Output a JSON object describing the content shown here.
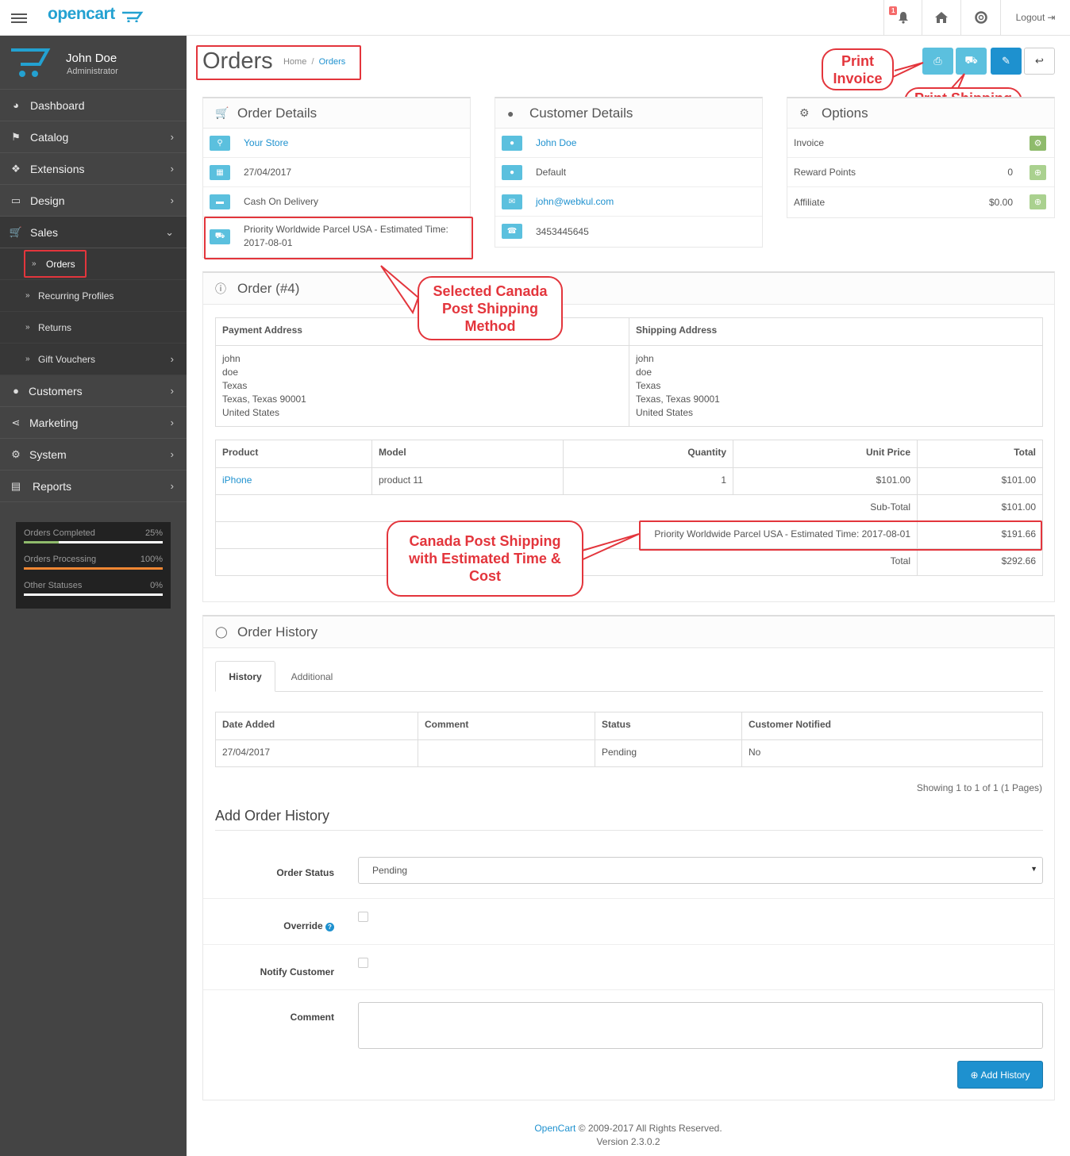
{
  "header": {
    "brand": "opencart",
    "notification_count": "1",
    "logout_label": "Logout"
  },
  "sidebar": {
    "user_name": "John Doe",
    "user_role": "Administrator",
    "items": [
      {
        "label": "Dashboard",
        "icon": "dashboard-icon"
      },
      {
        "label": "Catalog",
        "icon": "tags-icon"
      },
      {
        "label": "Extensions",
        "icon": "puzzle-icon"
      },
      {
        "label": "Design",
        "icon": "monitor-icon"
      },
      {
        "label": "Sales",
        "icon": "cart-icon"
      },
      {
        "label": "Customers",
        "icon": "user-icon"
      },
      {
        "label": "Marketing",
        "icon": "share-icon"
      },
      {
        "label": "System",
        "icon": "gear-icon"
      },
      {
        "label": "Reports",
        "icon": "bar-chart-icon"
      }
    ],
    "sales_sub": [
      "Orders",
      "Recurring Profiles",
      "Returns",
      "Gift Vouchers"
    ],
    "stats": [
      {
        "label": "Orders Completed",
        "percent": "25%",
        "value": 0.25,
        "color": "#8fbb6c"
      },
      {
        "label": "Orders Processing",
        "percent": "100%",
        "value": 1.0,
        "color": "#f38733"
      },
      {
        "label": "Other Statuses",
        "percent": "0%",
        "value": 0,
        "color": "#fff"
      }
    ]
  },
  "page": {
    "title": "Orders",
    "breadcrumb_home": "Home",
    "breadcrumb_current": "Orders"
  },
  "order_details": {
    "title": "Order Details",
    "store": "Your Store",
    "date": "27/04/2017",
    "payment": "Cash On Delivery",
    "shipping": "Priority Worldwide Parcel USA - Estimated Time: 2017-08-01"
  },
  "customer_details": {
    "title": "Customer Details",
    "name": "John Doe",
    "group": "Default",
    "email": "john@webkul.com",
    "phone": "3453445645"
  },
  "options": {
    "title": "Options",
    "invoice_label": "Invoice",
    "reward_label": "Reward Points",
    "reward_value": "0",
    "affiliate_label": "Affiliate",
    "affiliate_value": "$0.00"
  },
  "order": {
    "title": "Order (#4)",
    "payment_address_label": "Payment Address",
    "shipping_address_label": "Shipping Address",
    "payment_address": [
      "john",
      "doe",
      "Texas",
      "Texas, Texas 90001",
      "United States"
    ],
    "shipping_address": [
      "john",
      "doe",
      "Texas",
      "Texas, Texas 90001",
      "United States"
    ],
    "columns": [
      "Product",
      "Model",
      "Quantity",
      "Unit Price",
      "Total"
    ],
    "product": {
      "name": "iPhone",
      "model": "product 11",
      "qty": "1",
      "unit": "$101.00",
      "total": "$101.00"
    },
    "subtotal_label": "Sub-Total",
    "subtotal": "$101.00",
    "shipping_label": "Priority Worldwide Parcel USA - Estimated Time: 2017-08-01",
    "shipping_cost": "$191.66",
    "total_label": "Total",
    "total": "$292.66"
  },
  "history": {
    "title": "Order History",
    "tab_history": "History",
    "tab_additional": "Additional",
    "columns": [
      "Date Added",
      "Comment",
      "Status",
      "Customer Notified"
    ],
    "row": {
      "date": "27/04/2017",
      "comment": "",
      "status": "Pending",
      "notified": "No"
    },
    "pagination": "Showing 1 to 1 of 1 (1 Pages)"
  },
  "add_history": {
    "title": "Add Order History",
    "status_label": "Order Status",
    "status_value": "Pending",
    "override_label": "Override",
    "notify_label": "Notify Customer",
    "comment_label": "Comment",
    "button": "Add History"
  },
  "callouts": {
    "print_invoice": "Print Invoice",
    "print_shipping": "Print Shipping List",
    "selected_method": "Selected Canada Post Shipping Method",
    "shipping_cost": "Canada Post Shipping with Estimated Time & Cost"
  },
  "footer": {
    "brand": "OpenCart",
    "copyright": "© 2009-2017 All Rights Reserved.",
    "version": "Version 2.3.0.2"
  }
}
